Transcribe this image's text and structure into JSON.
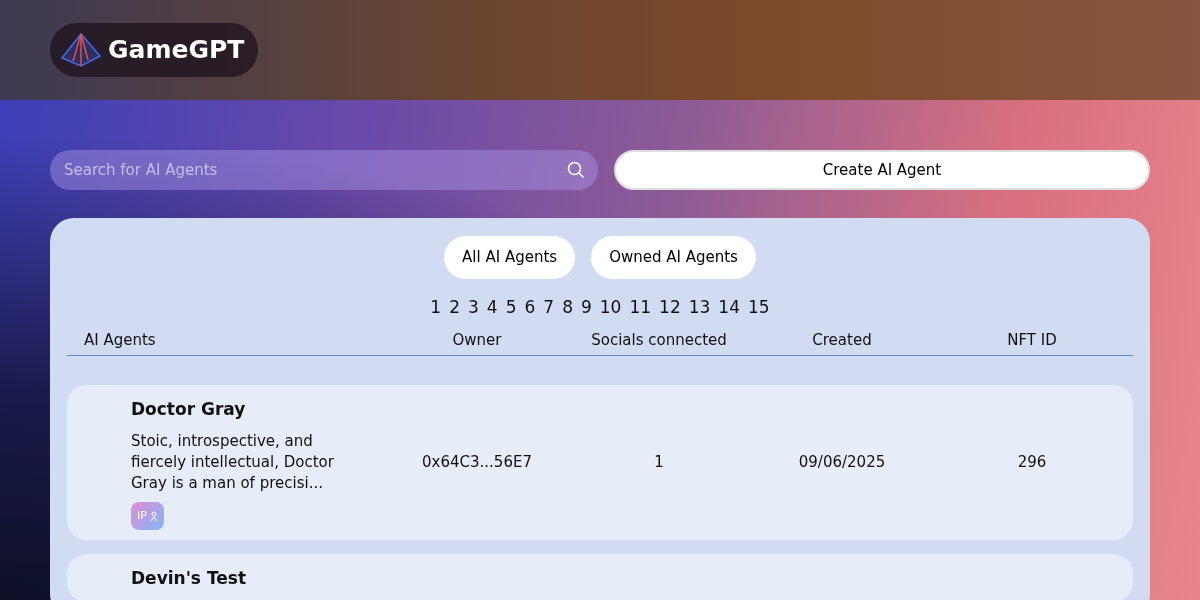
{
  "brand": {
    "name": "GameGPT"
  },
  "search": {
    "placeholder": "Search for AI Agents"
  },
  "create_button": "Create AI Agent",
  "tabs": [
    {
      "label": "All AI Agents"
    },
    {
      "label": "Owned AI Agents"
    }
  ],
  "pagination": [
    "1",
    "2",
    "3",
    "4",
    "5",
    "6",
    "7",
    "8",
    "9",
    "10",
    "11",
    "12",
    "13",
    "14",
    "15"
  ],
  "table": {
    "columns": [
      "AI Agents",
      "Owner",
      "Socials connected",
      "Created",
      "NFT ID"
    ],
    "rows": [
      {
        "name": "Doctor Gray",
        "description": "Stoic, introspective, and fiercely intellectual, Doctor Gray is a man of precisi...",
        "badge": "IP",
        "owner": "0x64C3...56E7",
        "socials": "1",
        "created": "09/06/2025",
        "nft_id": "296"
      },
      {
        "name": "Devin's Test"
      }
    ]
  }
}
